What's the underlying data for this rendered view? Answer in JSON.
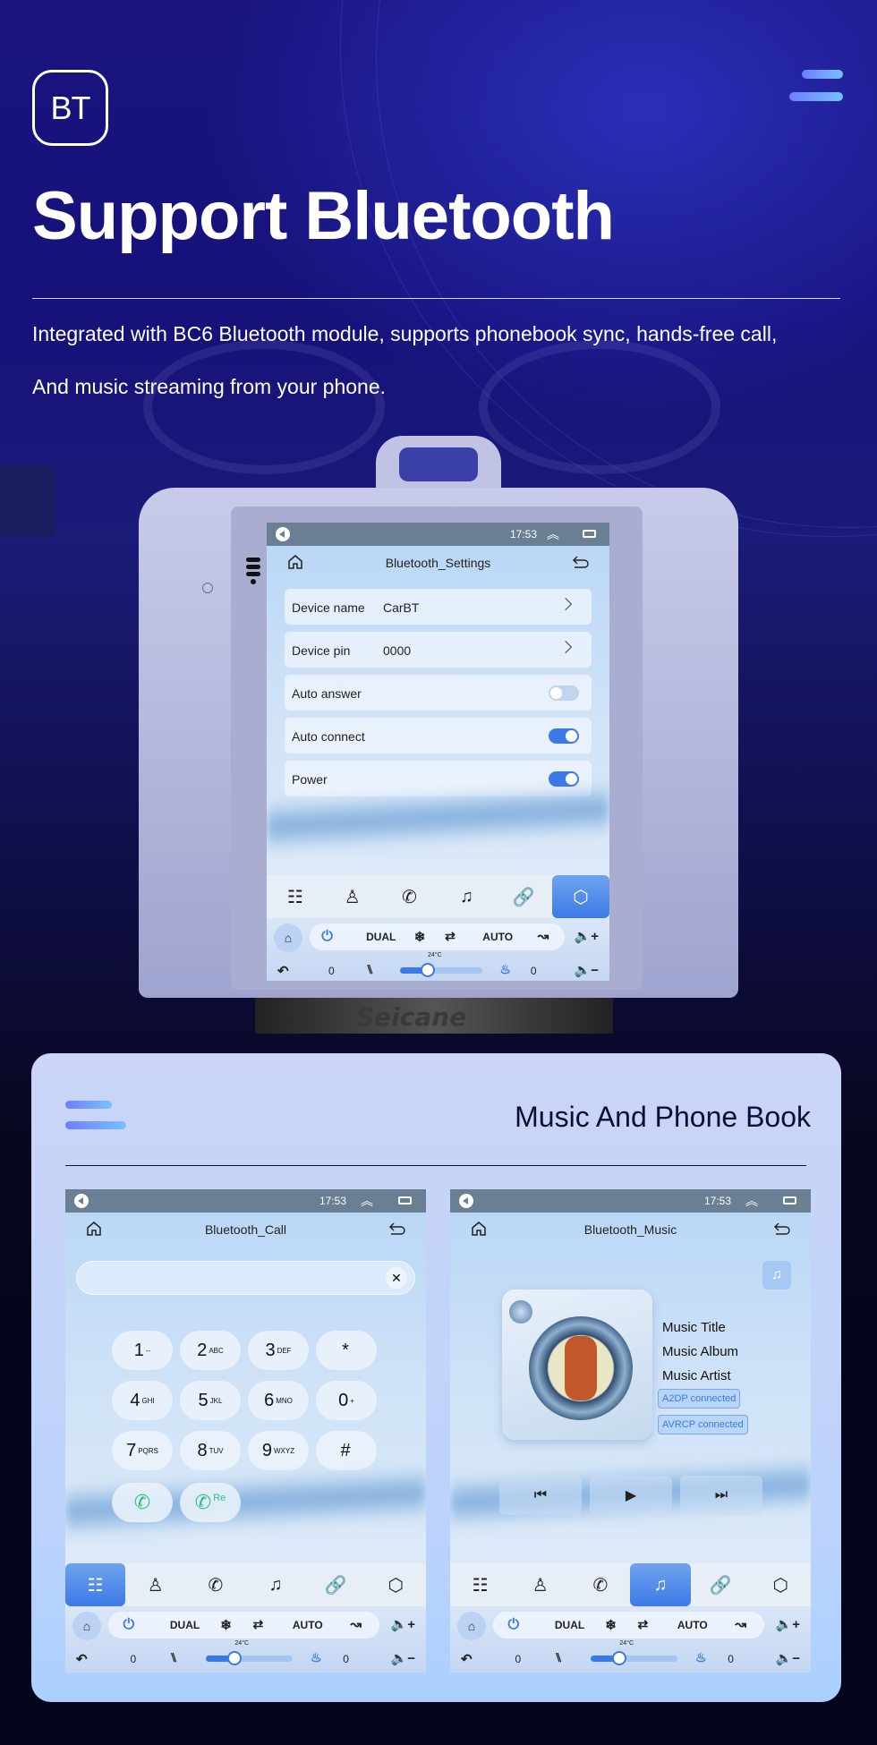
{
  "hero": {
    "badge": "BT",
    "title": "Support Bluetooth",
    "description_line1": "Integrated with BC6 Bluetooth module, supports phonebook sync, hands-free call,",
    "description_line2": "And music streaming from your phone.",
    "brand": "Seicane"
  },
  "status_bar": {
    "time": "17:53"
  },
  "settings_screen": {
    "title": "Bluetooth_Settings",
    "rows": [
      {
        "label": "Device name",
        "value": "CarBT",
        "type": "link"
      },
      {
        "label": "Device pin",
        "value": "0000",
        "type": "link"
      },
      {
        "label": "Auto answer",
        "type": "toggle",
        "on": false
      },
      {
        "label": "Auto connect",
        "type": "toggle",
        "on": true
      },
      {
        "label": "Power",
        "type": "toggle",
        "on": true
      }
    ],
    "active_tab": "settings"
  },
  "dock": {
    "items": [
      "apps-grid-icon",
      "contacts-icon",
      "phone-icon",
      "music-icon",
      "link-icon",
      "settings-icon"
    ],
    "glyphs": [
      "☷",
      "♙",
      "✆",
      "♫",
      "🔗",
      "⬡"
    ]
  },
  "climate": {
    "dual": "DUAL",
    "auto": "AUTO",
    "temp": "24°C",
    "left_seat_level": "0",
    "right_seat_level": "0",
    "fan_level_percent": 25
  },
  "section": {
    "title": "Music And Phone Book"
  },
  "call_screen": {
    "title": "Bluetooth_Call",
    "input_value": "",
    "keys": [
      {
        "d": "1",
        "s": "--"
      },
      {
        "d": "2",
        "s": "ABC"
      },
      {
        "d": "3",
        "s": "DEF"
      },
      {
        "d": "*",
        "s": ""
      },
      {
        "d": "4",
        "s": "GHI"
      },
      {
        "d": "5",
        "s": "JKL"
      },
      {
        "d": "6",
        "s": "MNO"
      },
      {
        "d": "0",
        "s": "+"
      },
      {
        "d": "7",
        "s": "PQRS"
      },
      {
        "d": "8",
        "s": "TUV"
      },
      {
        "d": "9",
        "s": "WXYZ"
      },
      {
        "d": "#",
        "s": ""
      }
    ],
    "redial_label": "Re",
    "active_tab": "apps"
  },
  "music_screen": {
    "title": "Bluetooth_Music",
    "track_title": "Music Title",
    "album": "Music Album",
    "artist": "Music Artist",
    "badges": [
      "A2DP  connected",
      "AVRCP connected"
    ],
    "active_tab": "music"
  }
}
